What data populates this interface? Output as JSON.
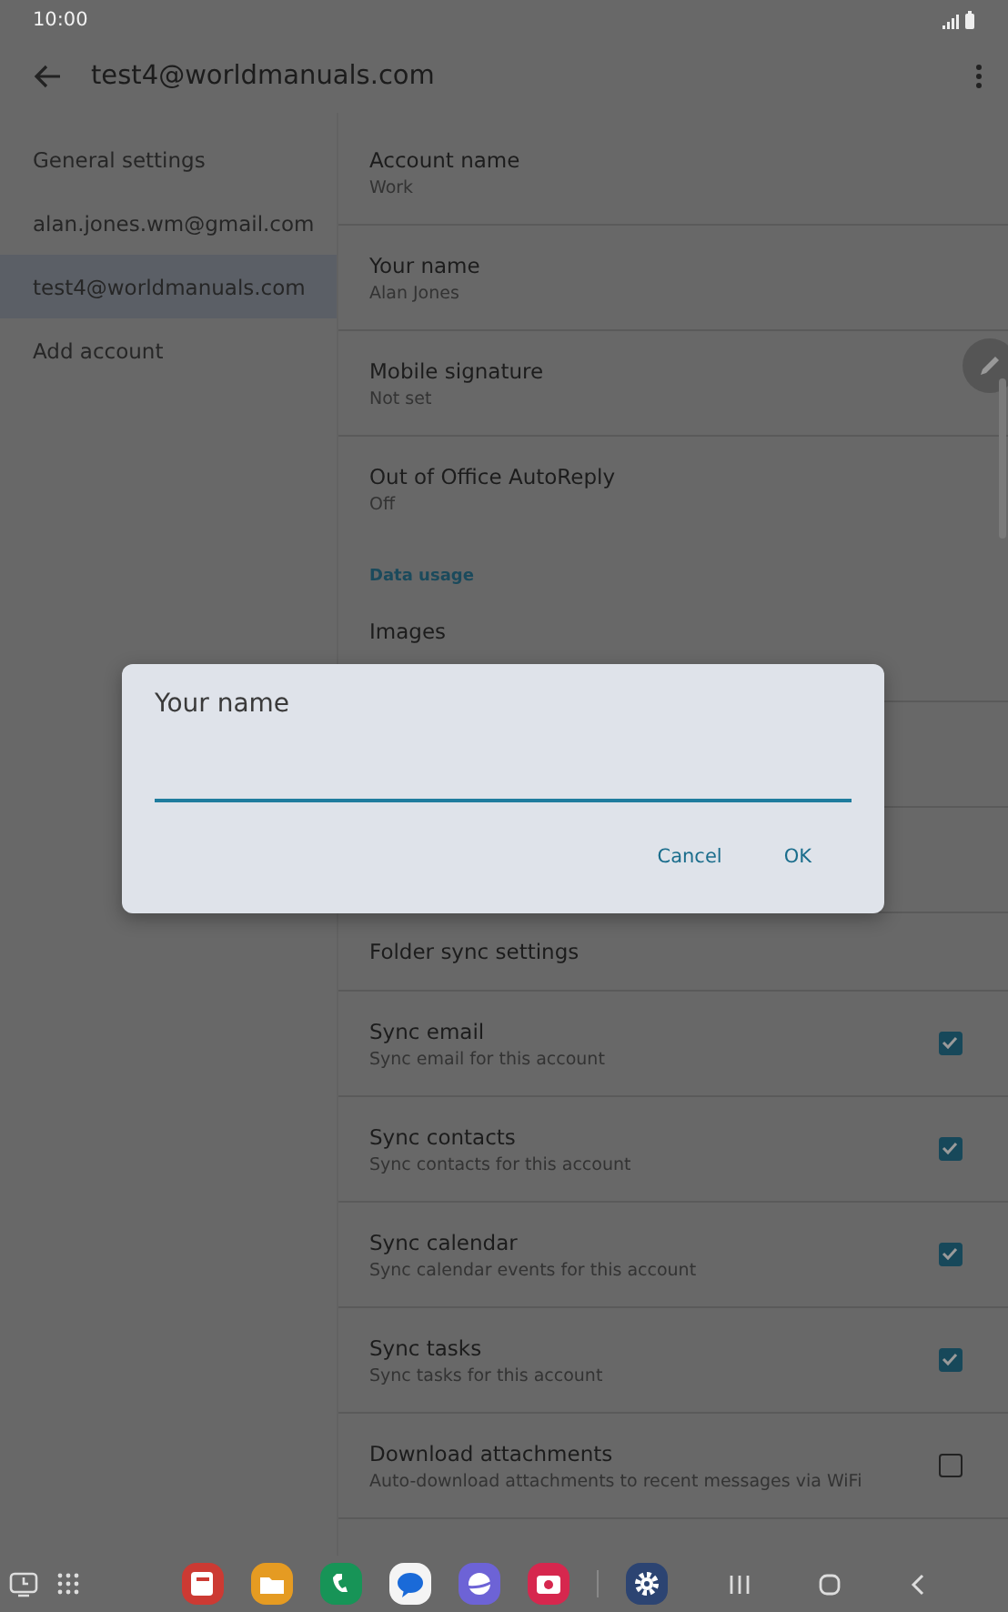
{
  "status_bar": {
    "time": "10:00"
  },
  "app_bar": {
    "title": "test4@worldmanuals.com"
  },
  "sidebar": {
    "items": [
      {
        "label": "General settings",
        "selected": false
      },
      {
        "label": "alan.jones.wm@gmail.com",
        "selected": false
      },
      {
        "label": "test4@worldmanuals.com",
        "selected": true
      },
      {
        "label": "Add account",
        "selected": false
      }
    ]
  },
  "settings": [
    {
      "kind": "setting",
      "title": "Account name",
      "subtitle": "Work"
    },
    {
      "kind": "setting",
      "title": "Your name",
      "subtitle": "Alan Jones"
    },
    {
      "kind": "setting",
      "title": "Mobile signature",
      "subtitle": "Not set"
    },
    {
      "kind": "setting",
      "title": "Out of Office AutoReply",
      "subtitle": "Off"
    },
    {
      "kind": "header",
      "title": "Data usage"
    },
    {
      "kind": "partial",
      "title": "Images"
    },
    {
      "kind": "hidden"
    },
    {
      "kind": "hidden"
    },
    {
      "kind": "setting",
      "title": "Folder sync settings"
    },
    {
      "kind": "checkbox",
      "title": "Sync email",
      "subtitle": "Sync email for this account",
      "checked": true
    },
    {
      "kind": "checkbox",
      "title": "Sync contacts",
      "subtitle": "Sync contacts for this account",
      "checked": true
    },
    {
      "kind": "checkbox",
      "title": "Sync calendar",
      "subtitle": "Sync calendar events for this account",
      "checked": true
    },
    {
      "kind": "checkbox",
      "title": "Sync tasks",
      "subtitle": "Sync tasks for this account",
      "checked": true
    },
    {
      "kind": "checkbox",
      "title": "Download attachments",
      "subtitle": "Auto-download attachments to recent messages via WiFi",
      "checked": false
    }
  ],
  "dialog": {
    "title": "Your name",
    "buttons": [
      "Cancel",
      "OK"
    ]
  }
}
